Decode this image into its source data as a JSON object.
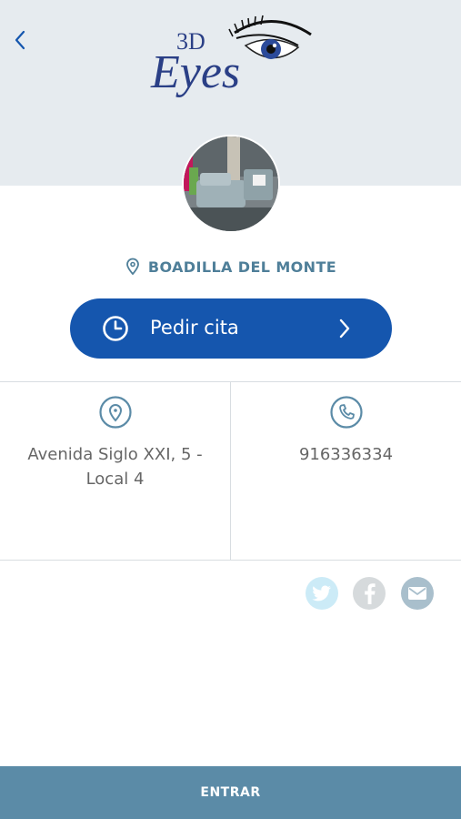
{
  "header": {
    "back_icon": "chevron-left-icon",
    "logo_text_small": "3D",
    "logo_text_large": "Eyes"
  },
  "profile": {
    "location_icon": "map-pin-icon",
    "location": "BOADILLA DEL MONTE"
  },
  "appointment": {
    "label": "Pedir cita",
    "icon": "clock-icon",
    "arrow_icon": "chevron-right-icon"
  },
  "info": {
    "address_icon": "map-pin-icon",
    "address": "Avenida Siglo XXI, 5 - Local 4",
    "phone_icon": "phone-icon",
    "phone": "916336334"
  },
  "social": {
    "items": [
      "twitter-icon",
      "facebook-icon",
      "email-icon"
    ]
  },
  "footer": {
    "enter_label": "ENTRAR"
  },
  "colors": {
    "header_bg": "#e6ebef",
    "primary": "#1556ae",
    "accent": "#4f7f99",
    "footer_bg": "#5b8ba7"
  }
}
